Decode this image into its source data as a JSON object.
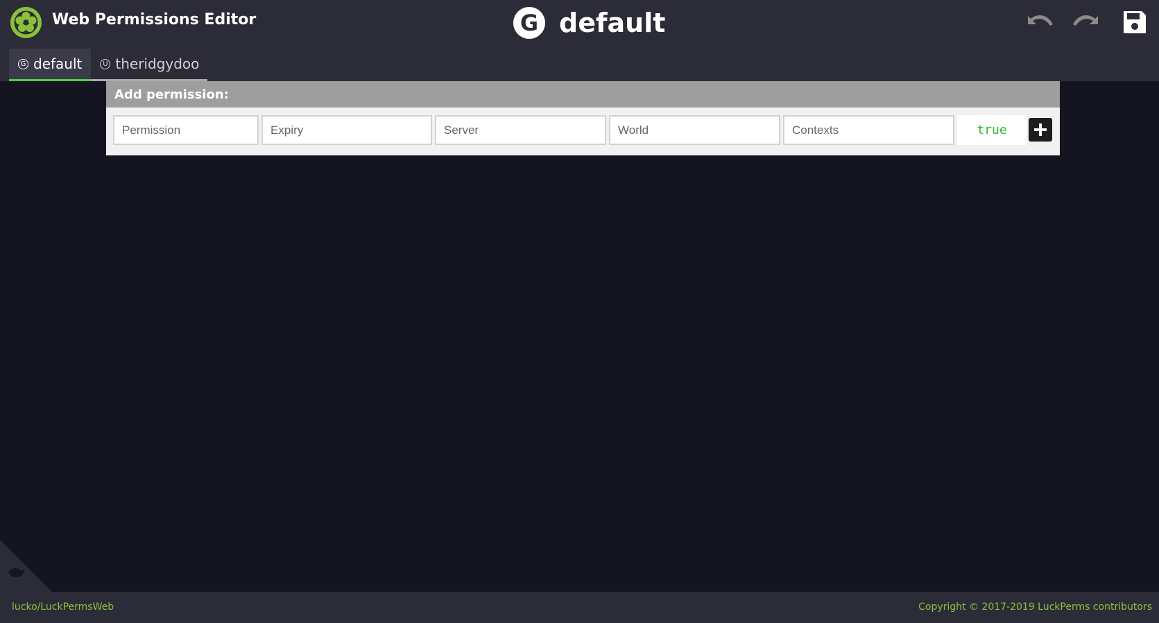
{
  "app": {
    "title": "Web Permissions Editor",
    "logo_icon": "luckperms-logo-icon"
  },
  "current": {
    "type_glyph": "G",
    "title": "default"
  },
  "toolbar": {
    "undo_icon": "undo-icon",
    "redo_icon": "redo-icon",
    "save_icon": "save-icon"
  },
  "tabs": [
    {
      "glyph": "G",
      "label": "default",
      "active": true
    },
    {
      "glyph": "U",
      "label": "theridgydoo",
      "active": false
    }
  ],
  "add_permission": {
    "heading": "Add permission:",
    "fields": {
      "permission": {
        "value": "",
        "placeholder": "Permission"
      },
      "expiry": {
        "value": "",
        "placeholder": "Expiry"
      },
      "server": {
        "value": "",
        "placeholder": "Server"
      },
      "world": {
        "value": "",
        "placeholder": "World"
      },
      "contexts": {
        "value": "",
        "placeholder": "Contexts"
      }
    },
    "value": "true",
    "add_icon": "plus-icon"
  },
  "footer": {
    "repo": "lucko/LuckPermsWeb",
    "copyright": "Copyright © 2017-2019 LuckPerms contributors"
  },
  "colors": {
    "background": "#151521",
    "header": "#2c2c38",
    "accent_green": "#8ac13a",
    "active_tab_underline": "#4cd04c",
    "true_value": "#2fc02f"
  }
}
